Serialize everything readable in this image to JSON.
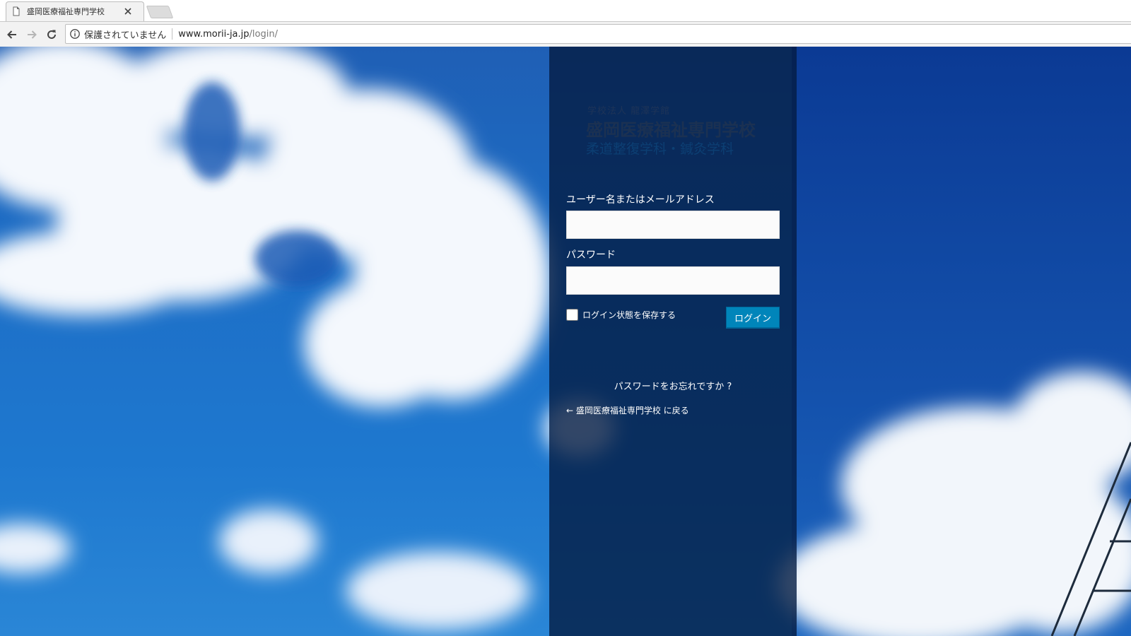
{
  "browser": {
    "tab_title": "盛岡医療福祉専門学校",
    "security_text": "保護されていません",
    "url_host": "www.morii-ja.jp",
    "url_path": "/login/"
  },
  "logo": {
    "line1": "学校法人 龍澤学館",
    "line2": "盛岡医療福祉専門学校",
    "line3": "柔道整復学科・鍼灸学科"
  },
  "login_form": {
    "username_label": "ユーザー名またはメールアドレス",
    "username_value": "",
    "password_label": "パスワード",
    "password_value": "",
    "remember_label": "ログイン状態を保存する",
    "remember_checked": false,
    "submit_label": "ログイン"
  },
  "links": {
    "lost_password": "パスワードをお忘れですか ?",
    "back_to_site": "← 盛岡医療福祉専門学校 に戻る"
  },
  "colors": {
    "panel": "#041c42",
    "button": "#0085ba",
    "sky": "#1e6ec6"
  }
}
